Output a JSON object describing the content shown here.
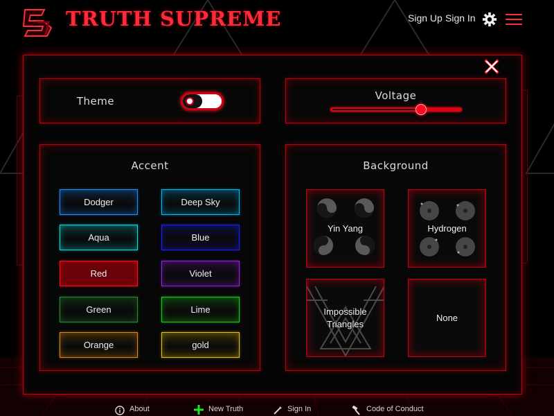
{
  "header": {
    "brand": "TRUTH SUPREME",
    "logo_icon": "truth-supreme-logo",
    "sign_up": "Sign Up",
    "sign_in": "Sign In",
    "settings_icon": "gear-icon",
    "menu_icon": "hamburger-icon"
  },
  "colors": {
    "accent": "#ff0a1a",
    "border": "#c0000e",
    "background": "#000000"
  },
  "settings": {
    "theme": {
      "label": "Theme",
      "value": "dark"
    },
    "voltage": {
      "label": "Voltage",
      "level": 0.69
    },
    "accent": {
      "title": "Accent",
      "selected": "Red",
      "options": [
        {
          "label": "Dodger",
          "color": "#1e90ff"
        },
        {
          "label": "Deep Sky",
          "color": "#00bfff"
        },
        {
          "label": "Aqua",
          "color": "#00e5e5"
        },
        {
          "label": "Blue",
          "color": "#2020ff"
        },
        {
          "label": "Red",
          "color": "#ff0a1a"
        },
        {
          "label": "Violet",
          "color": "#9a22e8"
        },
        {
          "label": "Green",
          "color": "#2e8b3a"
        },
        {
          "label": "Lime",
          "color": "#22d022"
        },
        {
          "label": "Orange",
          "color": "#e08a10"
        },
        {
          "label": "gold",
          "color": "#e8c010"
        }
      ]
    },
    "background": {
      "title": "Background",
      "options": [
        {
          "label": "Yin Yang",
          "icon": "yin-yang-icon"
        },
        {
          "label": "Hydrogen",
          "icon": "hydrogen-icon"
        },
        {
          "label": "Impossible Triangles",
          "line1": "Impossible",
          "line2": "Triangles",
          "icon": "impossible-triangle-icon"
        },
        {
          "label": "None"
        }
      ]
    }
  },
  "footer": {
    "about": "About",
    "new_truth": "New Truth",
    "sign_in": "Sign In",
    "code_of_conduct": "Code of Conduct"
  }
}
